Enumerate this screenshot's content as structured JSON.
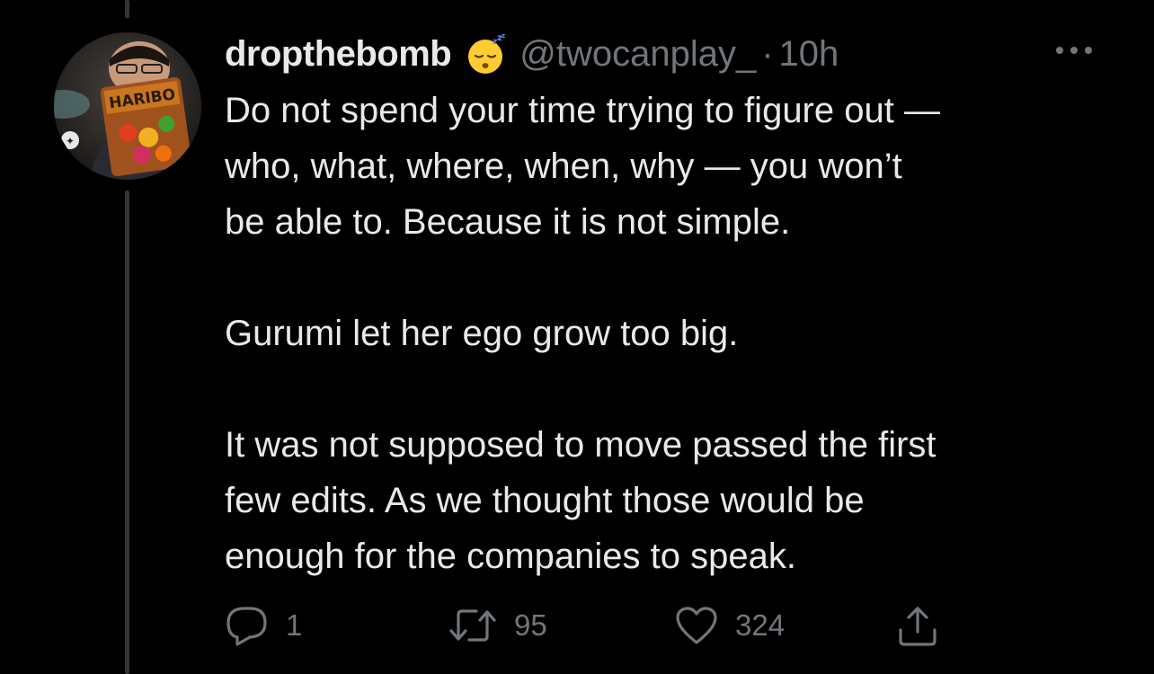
{
  "tweet": {
    "display_name": "dropthebomb",
    "name_emoji": "sleeping-face-emoji",
    "handle": "@twocanplay_",
    "separator": "·",
    "time": "10h",
    "paragraphs": [
      "Do not spend your time trying to figure out —\nwho, what, where, when, why — you won’t\nbe able to. Because it is not simple.",
      "Gurumi let her ego grow too big.",
      "It was not supposed to move passed the first\nfew edits. As we thought those would be\nenough for the companies to speak."
    ],
    "avatar_text": "HARIBO"
  },
  "actions": {
    "reply_count": "1",
    "retweet_count": "95",
    "like_count": "324"
  },
  "icons": {
    "more": "more-horizontal-icon",
    "reply": "reply-icon",
    "retweet": "retweet-icon",
    "like": "heart-icon",
    "share": "share-icon"
  },
  "colors": {
    "background": "#000000",
    "text": "#e7e9ea",
    "secondary": "#71767b",
    "thread_line": "#333639"
  }
}
